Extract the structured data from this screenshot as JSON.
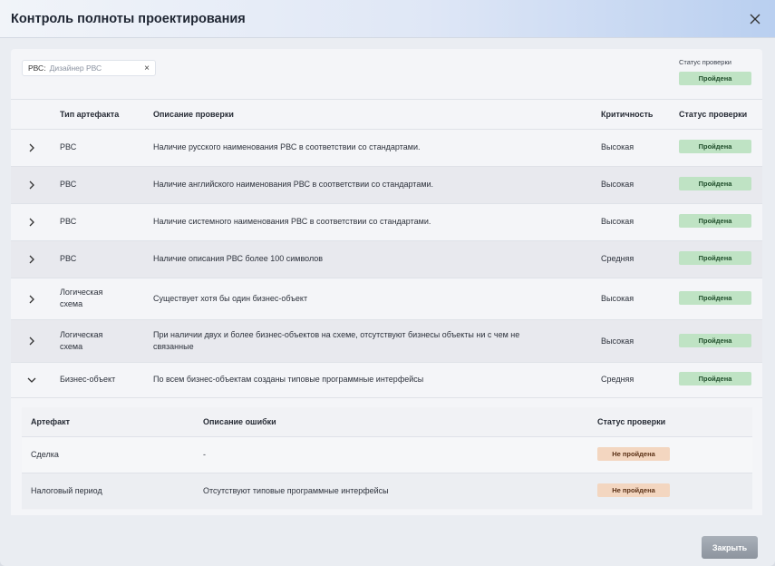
{
  "dialog": {
    "title": "Контроль полноты проектирования",
    "close_icon": "close-icon",
    "close_button_label": "Закрыть"
  },
  "filter": {
    "key": "РВС:",
    "value": "Дизайнер РВС",
    "clear_icon": "×"
  },
  "summary": {
    "label": "Статус проверки",
    "status": "Пройдена"
  },
  "table": {
    "headers": {
      "artifact_type": "Тип артефакта",
      "description": "Описание проверки",
      "criticality": "Критичность",
      "status": "Статус проверки"
    },
    "rows": [
      {
        "type": "РВС",
        "description": "Наличие русского наименования РВС в соответствии со стандартами.",
        "criticality": "Высокая",
        "status": "Пройдена",
        "expanded": false
      },
      {
        "type": "РВС",
        "description": "Наличие английского наименования РВС в соответствии со стандартами.",
        "criticality": "Высокая",
        "status": "Пройдена",
        "expanded": false
      },
      {
        "type": "РВС",
        "description": "Наличие системного наименования РВС в соответствии со стандартами.",
        "criticality": "Высокая",
        "status": "Пройдена",
        "expanded": false
      },
      {
        "type": "РВС",
        "description": "Наличие описания РВС более 100 символов",
        "criticality": "Средняя",
        "status": "Пройдена",
        "expanded": false
      },
      {
        "type_line1": "Логическая",
        "type_line2": "схема",
        "description": "Существует хотя бы один бизнес-объект",
        "criticality": "Высокая",
        "status": "Пройдена",
        "expanded": false
      },
      {
        "type_line1": "Логическая",
        "type_line2": "схема",
        "description_line1": "При наличии двух и более бизнес-объектов на схеме, отсутствуют бизнесы объекты ни с чем не",
        "description_line2": "связанные",
        "criticality": "Высокая",
        "status": "Пройдена",
        "expanded": false
      },
      {
        "type": "Бизнес-объект",
        "description": "По всем бизнес-объектам созданы типовые программные интерфейсы",
        "criticality": "Средняя",
        "status": "Пройдена",
        "expanded": true
      }
    ]
  },
  "subtable": {
    "headers": {
      "artifact": "Артефакт",
      "error": "Описание ошибки",
      "status": "Статус проверки"
    },
    "rows": [
      {
        "artifact": "Сделка",
        "error": "-",
        "status": "Не пройдена"
      },
      {
        "artifact": "Налоговый период",
        "error": "Отсутствуют типовые программные интерфейсы",
        "status": "Не пройдена"
      }
    ]
  },
  "colors": {
    "pass_bg": "#bfe3c4",
    "fail_bg": "#f3d6c0",
    "header_accent": "#b9cff0"
  }
}
